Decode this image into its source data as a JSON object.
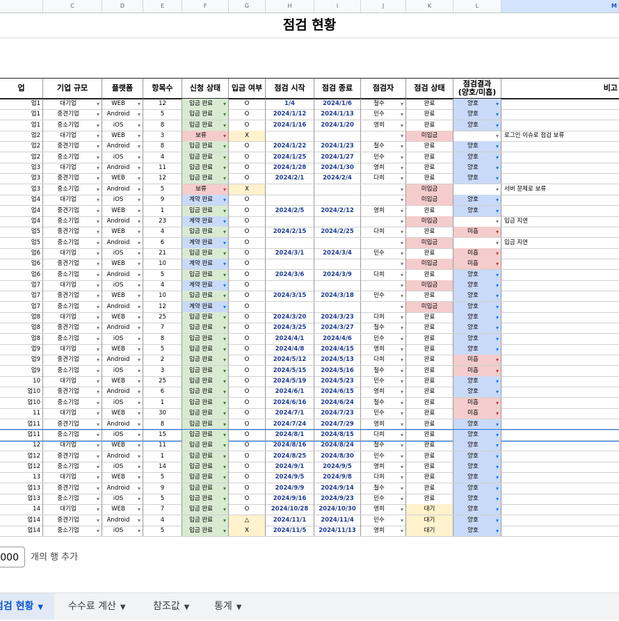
{
  "column_letters": [
    "C",
    "D",
    "E",
    "F",
    "G",
    "H",
    "I",
    "J",
    "K",
    "L",
    "M"
  ],
  "selected_column": "M",
  "title": "점검 현황",
  "headers": {
    "company": "업",
    "size": "기업 규모",
    "platform": "플랫폼",
    "items": "항목수",
    "app_status": "신청 상태",
    "deposit": "입금 여부",
    "start": "점검 시작",
    "end": "점검 종료",
    "inspector": "점검자",
    "insp_status": "점검 상태",
    "result_line1": "점검결과",
    "result_line2": "(양호/미흡)",
    "note": "비고"
  },
  "rows": [
    [
      "업1",
      "대기업",
      "WEB",
      "12",
      "입금 완료",
      "O",
      "1/4",
      "2024/1/6",
      "철수",
      "완료",
      "양호",
      ""
    ],
    [
      "업1",
      "중견기업",
      "Android",
      "5",
      "입금 완료",
      "O",
      "2024/1/12",
      "2024/1/13",
      "민수",
      "완료",
      "양호",
      ""
    ],
    [
      "업1",
      "중소기업",
      "iOS",
      "8",
      "입금 완료",
      "O",
      "2024/1/16",
      "2024/1/20",
      "영희",
      "완료",
      "양호",
      ""
    ],
    [
      "업2",
      "대기업",
      "WEB",
      "3",
      "보류",
      "X",
      "",
      "",
      "",
      "미입금",
      "",
      "로그인 이슈로 점검 보류"
    ],
    [
      "업2",
      "중견기업",
      "Android",
      "8",
      "입금 완료",
      "O",
      "2024/1/22",
      "2024/1/23",
      "철수",
      "완료",
      "양호",
      ""
    ],
    [
      "업2",
      "중소기업",
      "iOS",
      "4",
      "입금 완료",
      "O",
      "2024/1/25",
      "2024/1/27",
      "민수",
      "완료",
      "양호",
      ""
    ],
    [
      "업3",
      "대기업",
      "Android",
      "11",
      "입금 완료",
      "O",
      "2024/1/28",
      "2024/1/30",
      "영희",
      "완료",
      "양호",
      ""
    ],
    [
      "업3",
      "중견기업",
      "WEB",
      "12",
      "입금 완료",
      "O",
      "2024/2/1",
      "2024/2/4",
      "다희",
      "완료",
      "양호",
      ""
    ],
    [
      "업3",
      "중소기업",
      "Android",
      "5",
      "보류",
      "X",
      "",
      "",
      "",
      "미입금",
      "",
      "서버 문제로 보류"
    ],
    [
      "업4",
      "대기업",
      "iOS",
      "9",
      "계약 완료",
      "O",
      "",
      "",
      "",
      "미입금",
      "양호",
      ""
    ],
    [
      "업4",
      "중견기업",
      "WEB",
      "1",
      "입금 완료",
      "O",
      "2024/2/5",
      "2024/2/12",
      "영희",
      "완료",
      "양호",
      ""
    ],
    [
      "업4",
      "중소기업",
      "Android",
      "23",
      "계약 완료",
      "O",
      "",
      "",
      "",
      "미입금",
      "",
      "입금 지연"
    ],
    [
      "업5",
      "중견기업",
      "WEB",
      "4",
      "입금 완료",
      "O",
      "2024/2/15",
      "2024/2/25",
      "다희",
      "완료",
      "미흡",
      ""
    ],
    [
      "업5",
      "중소기업",
      "Android",
      "6",
      "계약 완료",
      "O",
      "",
      "",
      "",
      "미입금",
      "",
      "입금 지연"
    ],
    [
      "업6",
      "대기업",
      "iOS",
      "21",
      "입금 완료",
      "O",
      "2024/3/1",
      "2024/3/4",
      "민수",
      "완료",
      "미흡",
      ""
    ],
    [
      "업6",
      "중견기업",
      "WEB",
      "10",
      "계약 완료",
      "O",
      "",
      "",
      "",
      "미입금",
      "미흡",
      ""
    ],
    [
      "업6",
      "중소기업",
      "Android",
      "5",
      "입금 완료",
      "O",
      "2024/3/6",
      "2024/3/9",
      "다희",
      "완료",
      "양호",
      ""
    ],
    [
      "업7",
      "대기업",
      "iOS",
      "4",
      "계약 완료",
      "O",
      "",
      "",
      "",
      "미입금",
      "양호",
      ""
    ],
    [
      "업7",
      "중견기업",
      "WEB",
      "10",
      "입금 완료",
      "O",
      "2024/3/15",
      "2024/3/18",
      "민수",
      "완료",
      "양호",
      ""
    ],
    [
      "업7",
      "중소기업",
      "Android",
      "12",
      "계약 완료",
      "O",
      "",
      "",
      "",
      "미입금",
      "양호",
      ""
    ],
    [
      "업8",
      "대기업",
      "WEB",
      "25",
      "입금 완료",
      "O",
      "2024/3/20",
      "2024/3/23",
      "다희",
      "완료",
      "양호",
      ""
    ],
    [
      "업8",
      "중견기업",
      "Android",
      "7",
      "입금 완료",
      "O",
      "2024/3/25",
      "2024/3/27",
      "철수",
      "완료",
      "양호",
      ""
    ],
    [
      "업8",
      "중소기업",
      "iOS",
      "8",
      "입금 완료",
      "O",
      "2024/4/1",
      "2024/4/6",
      "민수",
      "완료",
      "양호",
      ""
    ],
    [
      "업9",
      "대기업",
      "WEB",
      "5",
      "입금 완료",
      "O",
      "2024/4/8",
      "2024/4/15",
      "영희",
      "완료",
      "양호",
      ""
    ],
    [
      "업9",
      "중견기업",
      "Android",
      "2",
      "입금 완료",
      "O",
      "2024/5/12",
      "2024/5/13",
      "다희",
      "완료",
      "미흡",
      ""
    ],
    [
      "업9",
      "중소기업",
      "iOS",
      "3",
      "입금 완료",
      "O",
      "2024/5/15",
      "2024/5/16",
      "철수",
      "완료",
      "미흡",
      ""
    ],
    [
      "10",
      "대기업",
      "WEB",
      "25",
      "입금 완료",
      "O",
      "2024/5/19",
      "2024/5/23",
      "민수",
      "완료",
      "양호",
      ""
    ],
    [
      "업10",
      "중견기업",
      "Android",
      "6",
      "입금 완료",
      "O",
      "2024/6/1",
      "2024/6/15",
      "영희",
      "완료",
      "양호",
      ""
    ],
    [
      "업10",
      "중소기업",
      "iOS",
      "1",
      "입금 완료",
      "O",
      "2024/6/16",
      "2024/6/24",
      "철수",
      "완료",
      "미흡",
      ""
    ],
    [
      "11",
      "대기업",
      "WEB",
      "30",
      "입금 완료",
      "O",
      "2024/7/1",
      "2024/7/23",
      "민수",
      "완료",
      "미흡",
      ""
    ],
    [
      "업11",
      "중견기업",
      "Android",
      "8",
      "입금 완료",
      "O",
      "2024/7/24",
      "2024/7/29",
      "영희",
      "완료",
      "양호",
      ""
    ],
    [
      "업11",
      "중소기업",
      "iOS",
      "15",
      "입금 완료",
      "O",
      "2024/8/1",
      "2024/8/15",
      "다희",
      "완료",
      "양호",
      ""
    ],
    [
      "12",
      "대기업",
      "WEB",
      "11",
      "입금 완료",
      "O",
      "2024/8/16",
      "2024/8/24",
      "철수",
      "완료",
      "양호",
      ""
    ],
    [
      "업12",
      "중견기업",
      "Android",
      "1",
      "입금 완료",
      "O",
      "2024/8/25",
      "2024/8/30",
      "민수",
      "완료",
      "양호",
      ""
    ],
    [
      "업12",
      "중소기업",
      "iOS",
      "14",
      "입금 완료",
      "O",
      "2024/9/1",
      "2024/9/5",
      "영희",
      "완료",
      "양호",
      ""
    ],
    [
      "13",
      "대기업",
      "WEB",
      "5",
      "입금 완료",
      "O",
      "2024/9/5",
      "2024/9/8",
      "다희",
      "완료",
      "양호",
      ""
    ],
    [
      "업13",
      "중견기업",
      "Android",
      "9",
      "입금 완료",
      "O",
      "2024/9/9",
      "2024/9/14",
      "철수",
      "완료",
      "양호",
      ""
    ],
    [
      "업13",
      "중소기업",
      "iOS",
      "5",
      "입금 완료",
      "O",
      "2024/9/16",
      "2024/9/23",
      "민수",
      "완료",
      "양호",
      ""
    ],
    [
      "14",
      "대기업",
      "WEB",
      "7",
      "입금 완료",
      "O",
      "2024/10/28",
      "2024/10/30",
      "영희",
      "대기",
      "양호",
      ""
    ],
    [
      "업14",
      "중견기업",
      "Android",
      "4",
      "입금 완료",
      "△",
      "2024/11/1",
      "2024/11/4",
      "민수",
      "대기",
      "양호",
      ""
    ],
    [
      "업14",
      "중소기업",
      "iOS",
      "5",
      "입금 완료",
      "X",
      "2024/11/5",
      "2024/11/13",
      "영희",
      "대기",
      "양호",
      ""
    ]
  ],
  "add_rows": {
    "count": "000",
    "label": "개의 행 추가"
  },
  "tabs": [
    {
      "label": "점검 현황",
      "active": true
    },
    {
      "label": "수수료 계산",
      "active": false
    },
    {
      "label": "참조값",
      "active": false
    },
    {
      "label": "통계",
      "active": false
    }
  ],
  "colors": {
    "status_done": "#d9ead3",
    "status_hold": "#f4cccc",
    "status_contract": "#c9daf8",
    "waiting": "#fff2cc",
    "selection": "#1a73e8"
  }
}
